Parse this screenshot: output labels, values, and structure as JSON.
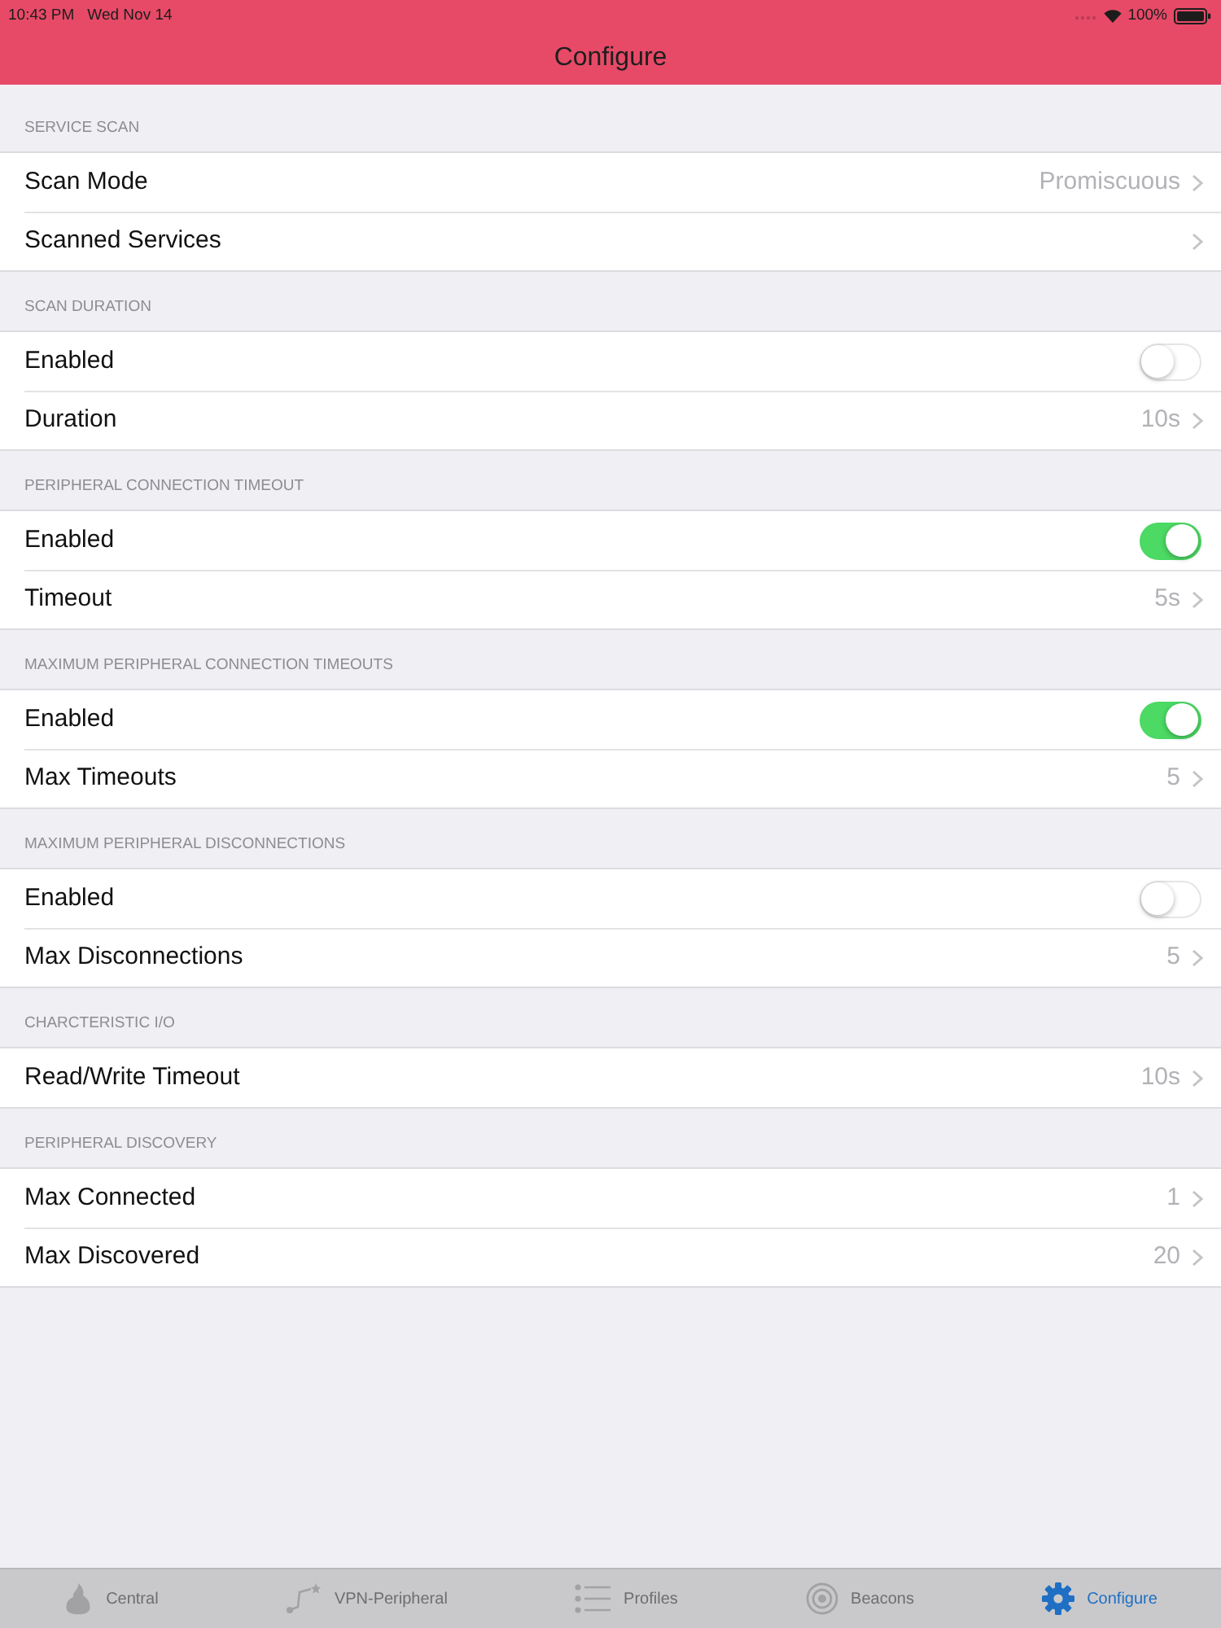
{
  "status_bar": {
    "time": "10:43 PM",
    "date": "Wed Nov 14",
    "battery": "100%"
  },
  "nav_bar": {
    "title": "Configure"
  },
  "sections": [
    {
      "header": "SERVICE SCAN",
      "rows": [
        {
          "kind": "disclosure",
          "label": "Scan Mode",
          "value": "Promiscuous"
        },
        {
          "kind": "disclosure",
          "label": "Scanned Services"
        }
      ]
    },
    {
      "header": "SCAN DURATION",
      "rows": [
        {
          "kind": "toggle",
          "label": "Enabled",
          "on": false
        },
        {
          "kind": "disclosure",
          "label": "Duration",
          "value": "10s"
        }
      ]
    },
    {
      "header": "PERIPHERAL CONNECTION TIMEOUT",
      "rows": [
        {
          "kind": "toggle",
          "label": "Enabled",
          "on": true
        },
        {
          "kind": "disclosure",
          "label": "Timeout",
          "value": "5s"
        }
      ]
    },
    {
      "header": "MAXIMUM PERIPHERAL CONNECTION TIMEOUTS",
      "rows": [
        {
          "kind": "toggle",
          "label": "Enabled",
          "on": true
        },
        {
          "kind": "disclosure",
          "label": "Max Timeouts",
          "value": "5"
        }
      ]
    },
    {
      "header": "MAXIMUM PERIPHERAL DISCONNECTIONS",
      "rows": [
        {
          "kind": "toggle",
          "label": "Enabled",
          "on": false
        },
        {
          "kind": "disclosure",
          "label": "Max Disconnections",
          "value": "5"
        }
      ]
    },
    {
      "header": "CHARCTERISTIC I/O",
      "rows": [
        {
          "kind": "disclosure",
          "label": "Read/Write Timeout",
          "value": "10s"
        }
      ]
    },
    {
      "header": "PERIPHERAL DISCOVERY",
      "rows": [
        {
          "kind": "disclosure",
          "label": "Max Connected",
          "value": "1"
        },
        {
          "kind": "disclosure",
          "label": "Max Discovered",
          "value": "20"
        }
      ]
    }
  ],
  "tab_bar": {
    "tabs": [
      {
        "label": "Central",
        "selected": false
      },
      {
        "label": "VPN-Peripheral",
        "selected": false
      },
      {
        "label": "Profiles",
        "selected": false
      },
      {
        "label": "Beacons",
        "selected": false
      },
      {
        "label": "Configure",
        "selected": true
      }
    ]
  }
}
